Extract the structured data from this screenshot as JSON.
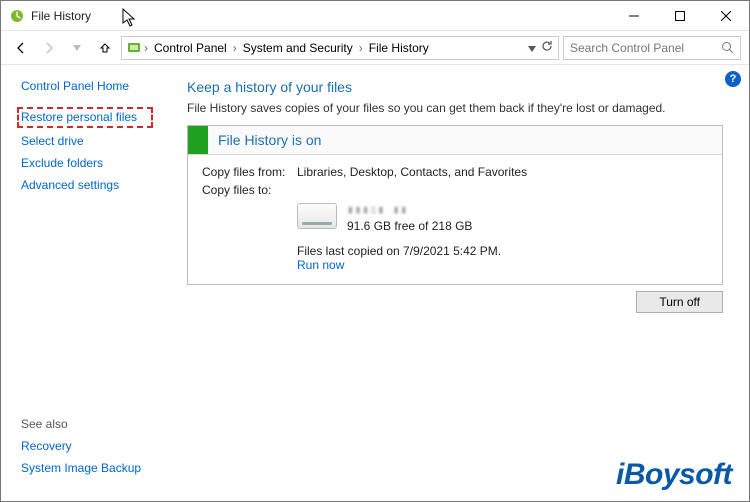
{
  "titlebar": {
    "title": "File History"
  },
  "nav": {
    "crumbs": [
      "Control Panel",
      "System and Security",
      "File History"
    ]
  },
  "search": {
    "placeholder": "Search Control Panel"
  },
  "sidebar": {
    "home": "Control Panel Home",
    "restore": "Restore personal files",
    "select_drive": "Select drive",
    "exclude": "Exclude folders",
    "advanced": "Advanced settings",
    "seealso": "See also",
    "recovery": "Recovery",
    "sysimg": "System Image Backup"
  },
  "main": {
    "heading": "Keep a history of your files",
    "desc": "File History saves copies of your files so you can get them back if they're lost or damaged.",
    "status_title": "File History is on",
    "copy_from_label": "Copy files from:",
    "copy_from_value": "Libraries, Desktop, Contacts, and Favorites",
    "copy_to_label": "Copy files to:",
    "drive_free": "91.6 GB free of 218 GB",
    "last_copied": "Files last copied on 7/9/2021 5:42 PM.",
    "run_now": "Run now",
    "turn_off": "Turn off"
  },
  "watermark": "iBoysoft"
}
